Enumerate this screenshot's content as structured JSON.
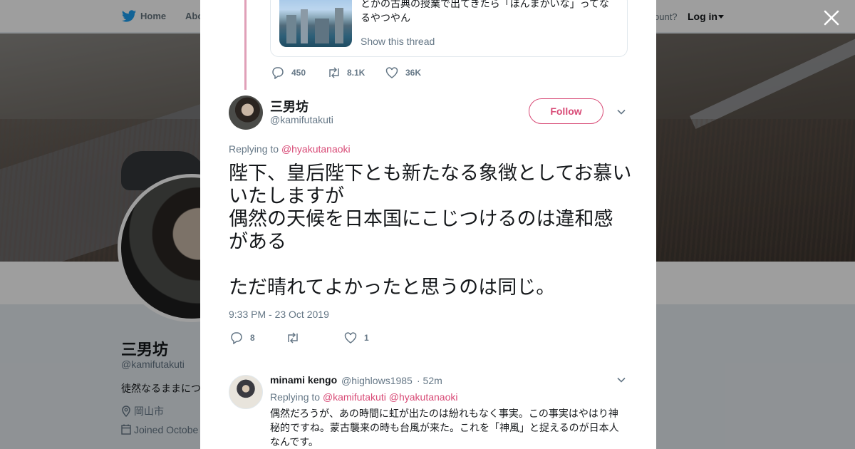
{
  "nav": {
    "home": "Home",
    "about": "Abo",
    "account_prompt": "ccount?",
    "login": "Log in"
  },
  "profile": {
    "name": "三男坊",
    "handle": "@kamifutakuti",
    "bio": "徒然なるままにつ",
    "location": "岡山市",
    "joined": "Joined Octobe"
  },
  "quoted": {
    "text": "とかの古典の授業で出てきたら「ほんまかいな」ってなるやつやん",
    "show_thread": "Show this thread",
    "replies": "450",
    "retweets": "8.1K",
    "likes": "36K"
  },
  "tweet": {
    "name": "三男坊",
    "handle": "@kamifutakuti",
    "follow_label": "Follow",
    "replying_prefix": "Replying to",
    "replying_mention": "@hyakutanaoki",
    "text": "陛下、皇后陛下とも新たなる象徴としてお慕いいたしますが\n偶然の天候を日本国にこじつけるのは違和感がある\n\nただ晴れてよかったと思うのは同じ。",
    "timestamp": "9:33 PM - 23 Oct 2019",
    "replies": "8",
    "retweets": "",
    "likes": "1"
  },
  "reply": {
    "name": "minami kengo",
    "handle": "@highlows1985",
    "time": "· 52m",
    "replying_prefix": "Replying to",
    "mention1": "@kamifutakuti",
    "mention2": "@hyakutanaoki",
    "text": "偶然だろうが、あの時間に虹が出たのは紛れもなく事実。この事実はやはり神秘的ですね。蒙古襲来の時も台風が来た。これを「神風」と捉えるのが日本人なんです。"
  },
  "colors": {
    "accent": "#d84a76",
    "twitter_blue": "#1da1f2",
    "secondary_text": "#657786"
  },
  "icons": [
    "twitter-bird-icon",
    "close-icon",
    "reply-icon",
    "retweet-icon",
    "like-icon",
    "chevron-down-icon",
    "location-icon",
    "calendar-icon"
  ]
}
